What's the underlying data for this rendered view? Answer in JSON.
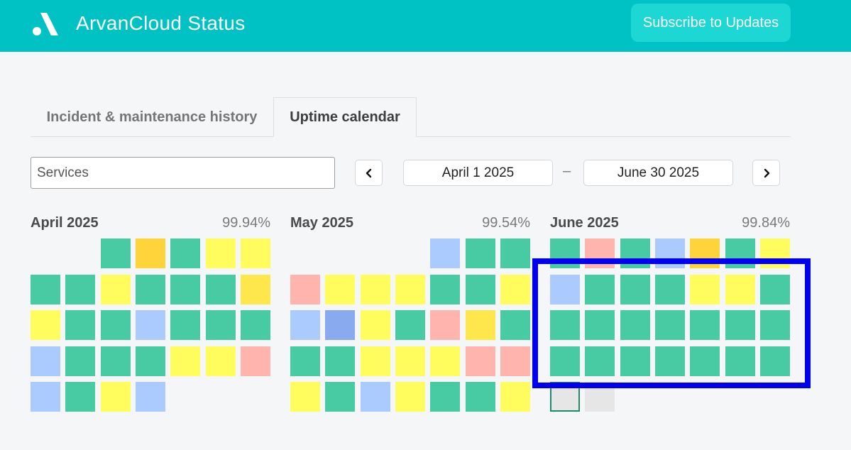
{
  "header": {
    "title": "ArvanCloud Status",
    "subscribe_label": "Subscribe to Updates",
    "logo_icon": "arvancloud-logo-icon",
    "background_color": "#00c1c3"
  },
  "tabs": [
    {
      "label": "Incident & maintenance history",
      "active": false
    },
    {
      "label": "Uptime calendar",
      "active": true
    }
  ],
  "filter": {
    "services_value": "Services",
    "prev_icon": "chevron-left-icon",
    "next_icon": "chevron-right-icon",
    "start_date": "April 1 2025",
    "separator": "–",
    "end_date": "June 30 2025"
  },
  "status_colors": {
    "operational": "#48cba2",
    "minor": "#fffd5e",
    "partial": "#fde74c",
    "major": "#ffd43b",
    "outage": "#ffb4ad",
    "maintenance": "#abcafe",
    "maintenance_dark": "#8aaaf0",
    "nodata": "#e6e6e6"
  },
  "months": [
    {
      "name": "April 2025",
      "uptime": "99.94%",
      "first_weekday": 2,
      "days": [
        "operational",
        "major",
        "operational",
        "minor",
        "minor",
        "operational",
        "operational",
        "minor",
        "operational",
        "operational",
        "operational",
        "partial",
        "minor",
        "operational",
        "operational",
        "maintenance",
        "operational",
        "operational",
        "operational",
        "maintenance",
        "operational",
        "operational",
        "operational",
        "minor",
        "minor",
        "outage",
        "maintenance",
        "operational",
        "minor",
        "maintenance"
      ]
    },
    {
      "name": "May 2025",
      "uptime": "99.54%",
      "first_weekday": 4,
      "days": [
        "maintenance",
        "operational",
        "operational",
        "outage",
        "minor",
        "minor",
        "minor",
        "operational",
        "operational",
        "minor",
        "maintenance",
        "maintenance_dark",
        "minor",
        "operational",
        "outage",
        "partial",
        "operational",
        "operational",
        "operational",
        "minor",
        "minor",
        "minor",
        "outage",
        "outage",
        "minor",
        "operational",
        "maintenance",
        "minor",
        "operational",
        "operational",
        "minor"
      ]
    },
    {
      "name": "June 2025",
      "uptime": "99.84%",
      "first_weekday": 0,
      "days": [
        "operational",
        "outage",
        "operational",
        "maintenance",
        "major",
        "operational",
        "minor",
        "maintenance",
        "operational",
        "operational",
        "operational",
        "minor",
        "minor",
        "operational",
        "operational",
        "operational",
        "operational",
        "operational",
        "operational",
        "operational",
        "operational",
        "operational",
        "operational",
        "operational",
        "operational",
        "operational",
        "operational",
        "operational",
        "nodata",
        "nodata"
      ],
      "selected_day": 28
    }
  ]
}
